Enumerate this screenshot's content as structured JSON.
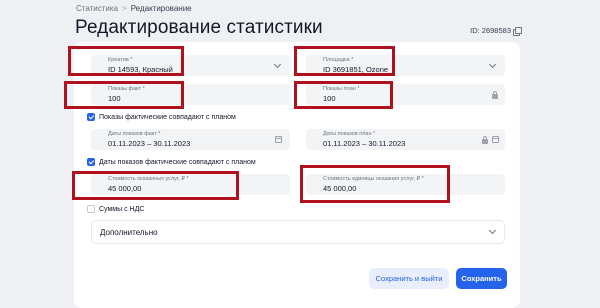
{
  "breadcrumb": {
    "parent": "Статистика",
    "separator": ">",
    "current": "Редактирование"
  },
  "page": {
    "title": "Редактирование статистики",
    "record_id": "ID: 2698583"
  },
  "form": {
    "creative": {
      "label": "Креатив *",
      "value": "ID 14593, Красный"
    },
    "platform": {
      "label": "Площадка *",
      "value": "ID 3691851, Ozone"
    },
    "impressions_fact": {
      "label": "Показы факт *",
      "value": "100"
    },
    "impressions_plan": {
      "label": "Показы план *",
      "value": "100"
    },
    "impressions_match_checkbox": {
      "label": "Показы фактические совпадают с планом",
      "checked": true
    },
    "dates_fact": {
      "label": "Даты показов факт *",
      "value": "01.11.2023 – 30.11.2023"
    },
    "dates_plan": {
      "label": "Даты показов план *",
      "value": "01.11.2023 – 30.11.2023"
    },
    "dates_match_checkbox": {
      "label": "Даты показов фактические совпадают с планом",
      "checked": true
    },
    "services_cost": {
      "label": "Стоимость оказанных услуг, ₽ *",
      "value": "45 000,00"
    },
    "unit_cost": {
      "label": "Стоимость единицы оказания услуг, ₽ *",
      "value": "45 000,00"
    },
    "vat_checkbox": {
      "label": "Суммы с НДС",
      "checked": false
    },
    "additional_section": {
      "label": "Дополнительно"
    }
  },
  "actions": {
    "save_and_exit": "Сохранить и выйти",
    "save": "Сохранить"
  },
  "colors": {
    "accent": "#2563eb",
    "highlight": "#b1101f",
    "field_bg": "#f3f4f6",
    "page_bg": "#eef0f3"
  },
  "icons": {
    "select": "chevron-down-icon",
    "locked": "lock-icon",
    "date": "calendar-icon",
    "copy": "copy-icon"
  }
}
